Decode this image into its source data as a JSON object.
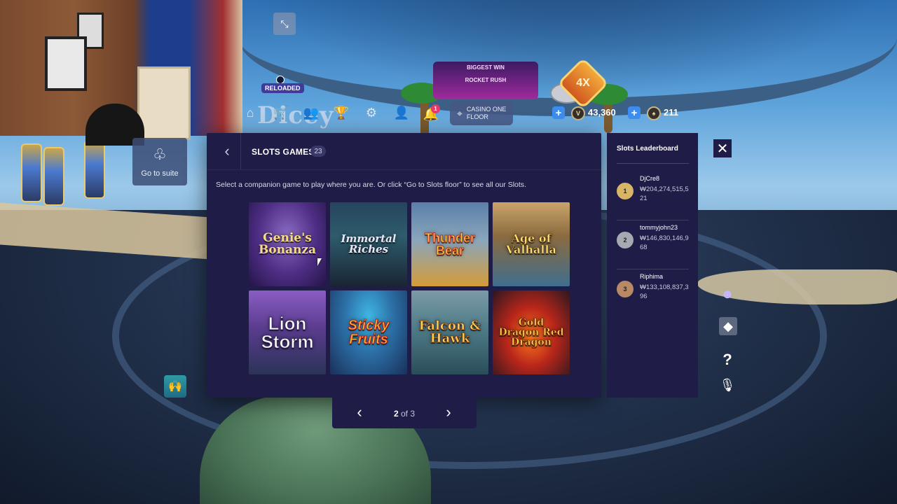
{
  "hud": {
    "logo_text": "Dicey",
    "reloaded_label": "RELOADED",
    "notification_count": "1",
    "location_label": "CASINO ONE FLOOR",
    "coins_value": "43,360",
    "chips_value": "211",
    "plus_label": "+",
    "multiplier_badge": "4X",
    "sign_line1": "BIGGEST WIN",
    "sign_line2": "ROCKET RUSH"
  },
  "suite": {
    "label": "Go to suite"
  },
  "modal": {
    "title": "SLOTS GAMES",
    "count": "23",
    "description": "Select a companion game to play where you are. Or click “Go to Slots floor” to see all our Slots.",
    "games": [
      {
        "name": "Genie's Bonanza"
      },
      {
        "name": "Immortal Riches"
      },
      {
        "name": "Thunder Bear"
      },
      {
        "name": "Age of Valhalla"
      },
      {
        "name": "Lion Storm"
      },
      {
        "name": "Sticky Fruits"
      },
      {
        "name": "Falcon & Hawk"
      },
      {
        "name": "Gold Dragon Red Dragon"
      }
    ]
  },
  "pager": {
    "current": "2",
    "of_text": "of 3"
  },
  "leaderboard": {
    "title": "Slots Leaderboard",
    "entries": [
      {
        "rank": "1",
        "name": "DjCre8",
        "score": "₩204,274,515,521",
        "color": "#d8b566"
      },
      {
        "rank": "2",
        "name": "tommyjohn23",
        "score": "₩146,830,146,968",
        "color": "#a7a9b2"
      },
      {
        "rank": "3",
        "name": "Riphima",
        "score": "₩133,108,837,396",
        "color": "#b98865"
      }
    ]
  },
  "colors": {
    "panel": "#1f1d48",
    "accent": "#3d8df0",
    "notif": "#e23b6a"
  }
}
